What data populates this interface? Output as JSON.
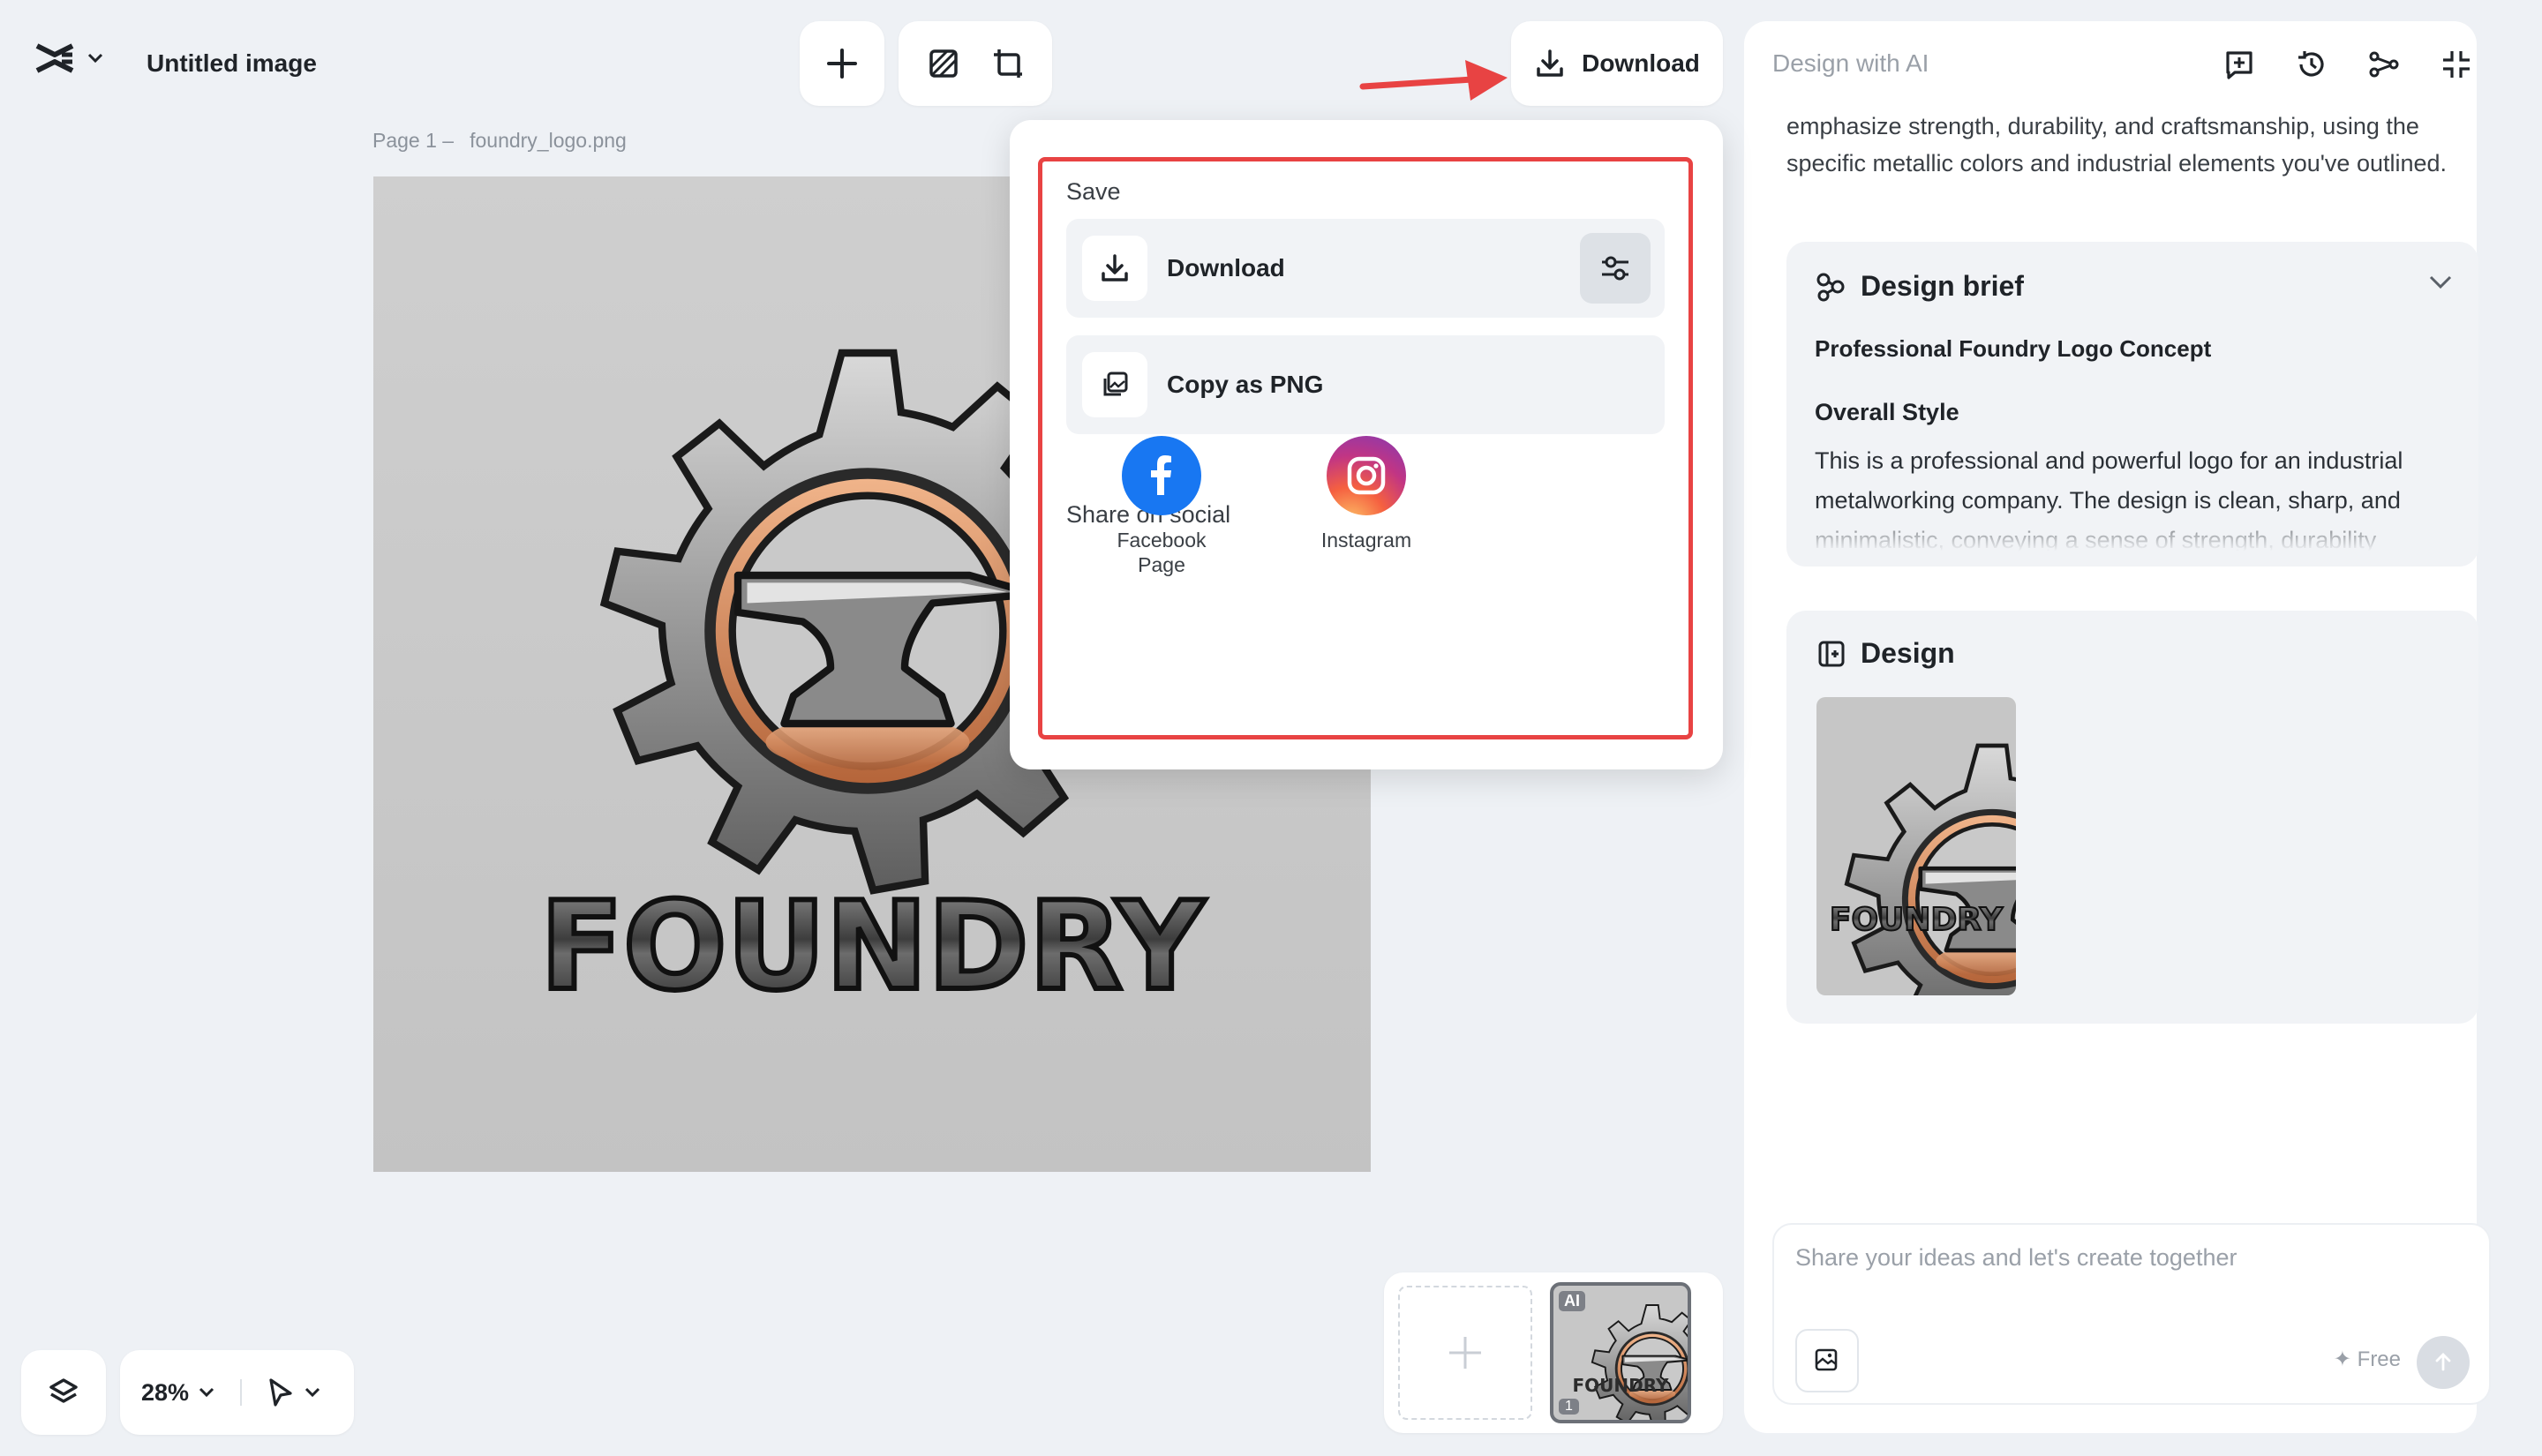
{
  "header": {
    "doc_title": "Untitled image",
    "download_label": "Download"
  },
  "page": {
    "page_num": "Page 1 –",
    "file_name": "foundry_logo.png"
  },
  "canvas": {
    "logo_text": "FOUNDRY"
  },
  "bottom": {
    "zoom": "28%"
  },
  "strip": {
    "badge_ai": "AI",
    "badge_num": "1"
  },
  "dropdown": {
    "save_heading": "Save",
    "download_label": "Download",
    "copy_label": "Copy as PNG",
    "social_heading": "Share on social",
    "facebook_label": "Facebook Page",
    "instagram_label": "Instagram"
  },
  "panel": {
    "title": "Design with AI",
    "intro": "emphasize strength, durability, and craftsmanship, using the specific metallic colors and industrial elements you've outlined.",
    "brief": {
      "heading": "Design brief",
      "subtitle": "Professional Foundry Logo Concept",
      "style_heading": "Overall Style",
      "body": "This is a professional and powerful logo for an industrial metalworking company. The design is clean, sharp, and minimalistic, conveying a sense of strength, durability"
    },
    "design_heading": "Design",
    "chat_placeholder": "Share your ideas and let's create together",
    "free_label": "✦ Free"
  },
  "colors": {
    "accent_red": "#e84343",
    "facebook_blue": "#1877f2",
    "panel_bg": "#f1f3f6"
  }
}
